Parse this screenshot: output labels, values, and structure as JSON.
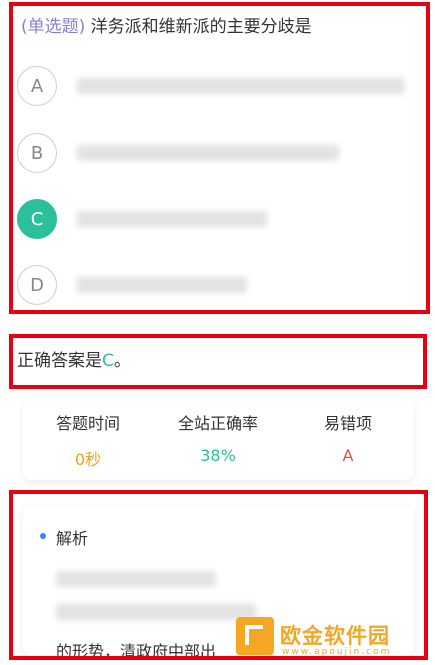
{
  "question": {
    "type_label": "(单选题)",
    "text": " 洋务派和维新派的主要分歧是",
    "options": [
      {
        "letter": "A",
        "selected": false
      },
      {
        "letter": "B",
        "selected": false
      },
      {
        "letter": "C",
        "selected": true
      },
      {
        "letter": "D",
        "selected": false
      }
    ]
  },
  "answer": {
    "prefix": "正确答案是",
    "letter": "C",
    "suffix": "。"
  },
  "stats": {
    "time_label": "答题时间",
    "time_value": "0秒",
    "rate_label": "全站正确率",
    "rate_value": "38%",
    "wrong_label": "易错项",
    "wrong_value": "A"
  },
  "explanation": {
    "title": "解析",
    "visible_text": "的形势，清政府中部出"
  },
  "watermark": {
    "name": "欧金软件园",
    "url": "www.apoujin.com"
  },
  "colors": {
    "accent_green": "#2bbf9b",
    "type_purple": "#8a7fd6",
    "time_orange": "#f0a020",
    "wrong_red": "#e05050",
    "frame_red": "#e60012"
  }
}
